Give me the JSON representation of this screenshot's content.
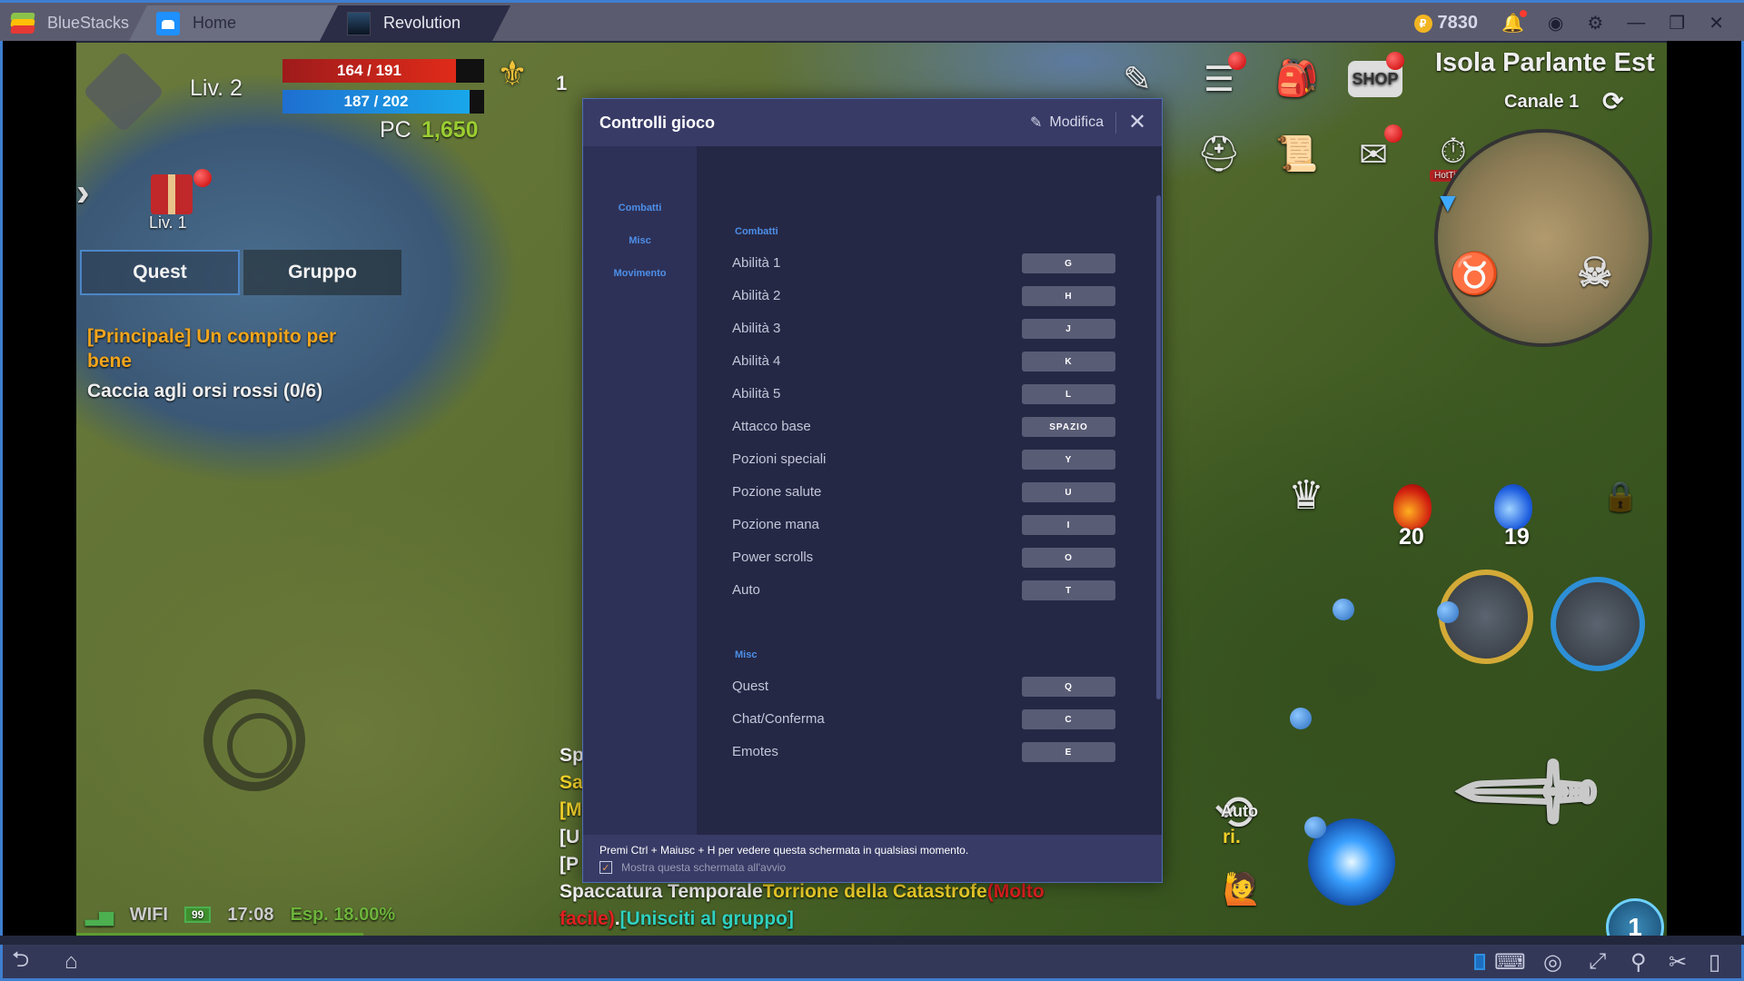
{
  "titlebar": {
    "brand": "BlueStacks",
    "tabs": [
      {
        "label": "Home",
        "icon": "home-icon"
      },
      {
        "label": "Revolution",
        "icon": "game-icon"
      }
    ],
    "coins": "7830",
    "coin_symbol": "₽",
    "icons": [
      "notification-bell-icon",
      "profile-icon",
      "settings-gear-icon",
      "minimize-icon",
      "restore-icon",
      "close-icon"
    ]
  },
  "game": {
    "level": "Liv. 2",
    "hp": "164 / 191",
    "hp_fraction": 0.859,
    "mp": "187 / 202",
    "mp_fraction": 0.926,
    "pc_label": "PC",
    "pc_value": "1,650",
    "rank": "1",
    "gift_level": "Liv. 1",
    "quest_tabs": [
      "Quest",
      "Gruppo"
    ],
    "quest_title": "[Principale] Un compito per bene",
    "quest_task": "Caccia agli orsi rossi (0/6)",
    "location": "Isola Parlante Est",
    "channel": "Canale 1",
    "shop_label": "SHOP",
    "hottime_label": "HotTime",
    "hp_potions": "20",
    "mp_potions": "19",
    "auto_label": "Auto",
    "skill_count": "1",
    "chat": {
      "line1": "Sp",
      "line2": "Sa",
      "line3": "[M",
      "line4": "[U",
      "line4_end": "ri.",
      "line5": "[P",
      "line6_white": "Spaccatura Temporale",
      "line6_yellow": "Torrione della Catastrofe",
      "line6_red": "(Molto",
      "line7_red": "facile)",
      "line7_white": ".",
      "line7_cyan": "[Unisciti al gruppo]"
    },
    "status": {
      "network": "WIFI",
      "battery": "99",
      "time": "17:08",
      "exp": "Esp. 18.00%"
    }
  },
  "dialog": {
    "title": "Controlli gioco",
    "edit_label": "Modifica",
    "sidebar": [
      "Combatti",
      "Misc",
      "Movimento"
    ],
    "sections": [
      {
        "title": "Combatti",
        "rows": [
          {
            "label": "Abilità 1",
            "key": "G"
          },
          {
            "label": "Abilità 2",
            "key": "H"
          },
          {
            "label": "Abilità 3",
            "key": "J"
          },
          {
            "label": "Abilità 4",
            "key": "K"
          },
          {
            "label": "Abilità 5",
            "key": "L"
          },
          {
            "label": "Attacco base",
            "key": "SPAZIO"
          },
          {
            "label": "Pozioni speciali",
            "key": "Y"
          },
          {
            "label": "Pozione salute",
            "key": "U"
          },
          {
            "label": "Pozione mana",
            "key": "I"
          },
          {
            "label": "Power scrolls",
            "key": "O"
          },
          {
            "label": "Auto",
            "key": "T"
          }
        ]
      },
      {
        "title": "Misc",
        "rows": [
          {
            "label": "Quest",
            "key": "Q"
          },
          {
            "label": "Chat/Conferma",
            "key": "C"
          },
          {
            "label": "Emotes",
            "key": "E"
          }
        ]
      }
    ],
    "footer_hint": "Premi Ctrl + Maiusc + H per vedere questa schermata in qualsiasi momento.",
    "show_on_start_label": "Mostra questa schermata all'avvio",
    "show_on_start_checked": true
  },
  "bottombar": {
    "left_icons": [
      "back-icon",
      "home-icon"
    ],
    "right_icons": [
      "keyboard-toggle-icon",
      "keymapping-icon",
      "eye-off-icon",
      "fullscreen-icon",
      "location-icon",
      "scissors-icon",
      "rotate-device-icon"
    ]
  }
}
